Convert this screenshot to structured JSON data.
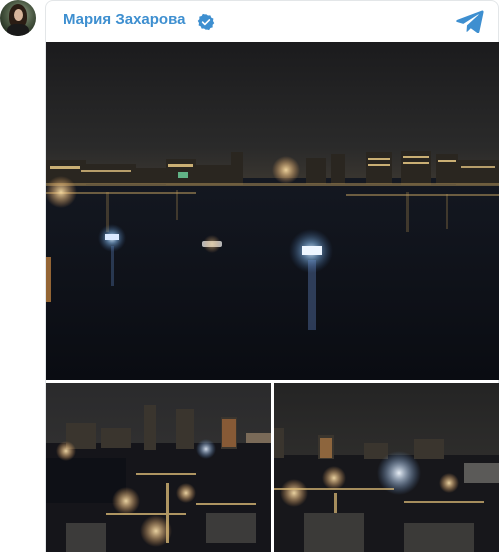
{
  "post": {
    "author_name": "Мария Захарова",
    "verified": true,
    "channel_icon": "telegram-icon",
    "avatar_icon": "avatar",
    "photos": [
      {
        "name": "night-river-panorama"
      },
      {
        "name": "night-city-aerial-left"
      },
      {
        "name": "night-city-aerial-right"
      }
    ]
  },
  "colors": {
    "accent": "#3e8fd0",
    "verified_badge": "#3e8fd0",
    "telegram": "#3e8fd0"
  }
}
